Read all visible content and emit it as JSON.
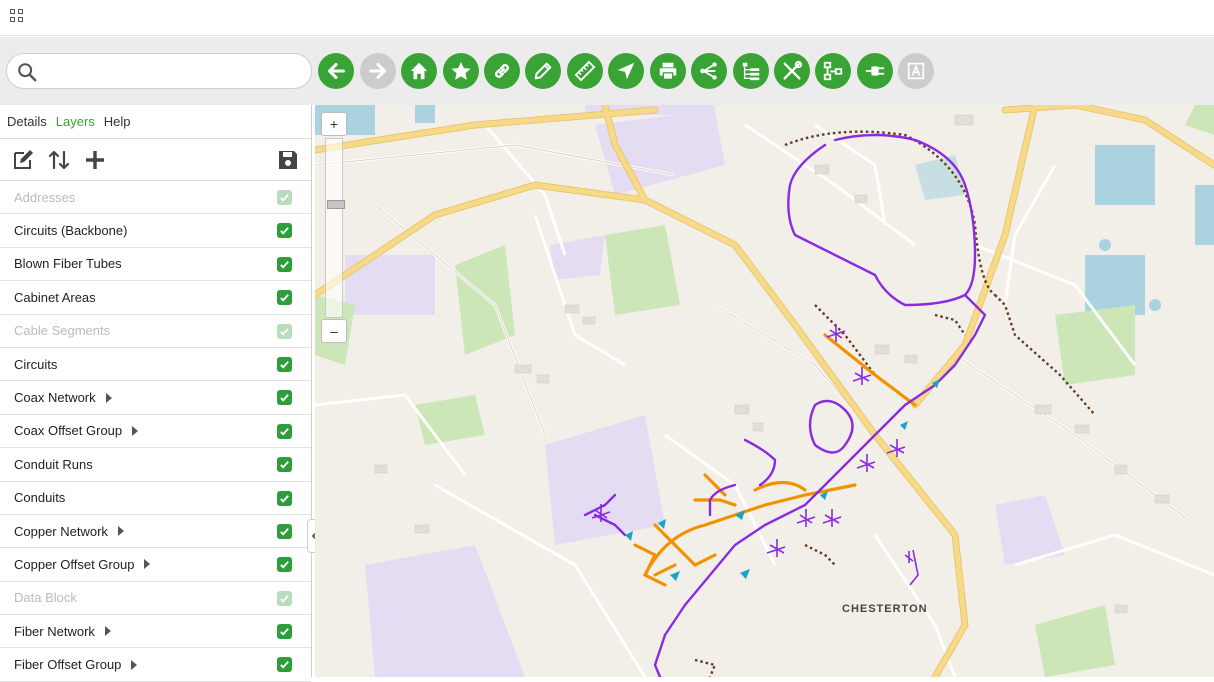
{
  "app": {
    "grid_icon": "apps-grid-icon"
  },
  "search": {
    "placeholder": "",
    "icon": "search-icon"
  },
  "toolbar": {
    "buttons": [
      {
        "icon": "arrow-left-icon",
        "enabled": true
      },
      {
        "icon": "arrow-right-icon",
        "enabled": false
      },
      {
        "icon": "home-icon",
        "enabled": true
      },
      {
        "icon": "star-icon",
        "enabled": true
      },
      {
        "icon": "link-icon",
        "enabled": true
      },
      {
        "icon": "pencil-icon",
        "enabled": true
      },
      {
        "icon": "ruler-icon",
        "enabled": true
      },
      {
        "icon": "navigate-icon",
        "enabled": true
      },
      {
        "icon": "printer-icon",
        "enabled": true
      },
      {
        "icon": "share-icon",
        "enabled": true
      },
      {
        "icon": "tree-list-icon",
        "enabled": true
      },
      {
        "icon": "tools-icon",
        "enabled": true
      },
      {
        "icon": "network-diagram-icon",
        "enabled": true
      },
      {
        "icon": "plug-icon",
        "enabled": true
      },
      {
        "icon": "text-tool-icon",
        "enabled": false
      }
    ],
    "accent": "#3aa335",
    "disabled_color": "#cccccc"
  },
  "panel": {
    "tabs": [
      {
        "label": "Details",
        "active": false
      },
      {
        "label": "Layers",
        "active": true
      },
      {
        "label": "Help",
        "active": false
      }
    ],
    "tools": [
      "edit-icon",
      "sort-icon",
      "add-icon",
      "save-icon"
    ],
    "layers": [
      {
        "label": "Addresses",
        "enabled": false,
        "checked": true,
        "expandable": false
      },
      {
        "label": "Circuits (Backbone)",
        "enabled": true,
        "checked": true,
        "expandable": false
      },
      {
        "label": "Blown Fiber Tubes",
        "enabled": true,
        "checked": true,
        "expandable": false
      },
      {
        "label": "Cabinet Areas",
        "enabled": true,
        "checked": true,
        "expandable": false
      },
      {
        "label": "Cable Segments",
        "enabled": false,
        "checked": true,
        "expandable": false
      },
      {
        "label": "Circuits",
        "enabled": true,
        "checked": true,
        "expandable": false
      },
      {
        "label": "Coax Network",
        "enabled": true,
        "checked": true,
        "expandable": true
      },
      {
        "label": "Coax Offset Group",
        "enabled": true,
        "checked": true,
        "expandable": true
      },
      {
        "label": "Conduit Runs",
        "enabled": true,
        "checked": true,
        "expandable": false
      },
      {
        "label": "Conduits",
        "enabled": true,
        "checked": true,
        "expandable": false
      },
      {
        "label": "Copper Network",
        "enabled": true,
        "checked": true,
        "expandable": true
      },
      {
        "label": "Copper Offset Group",
        "enabled": true,
        "checked": true,
        "expandable": true
      },
      {
        "label": "Data Block",
        "enabled": false,
        "checked": true,
        "expandable": false
      },
      {
        "label": "Fiber Network",
        "enabled": true,
        "checked": true,
        "expandable": true
      },
      {
        "label": "Fiber Offset Group",
        "enabled": true,
        "checked": true,
        "expandable": true
      }
    ],
    "check_color": "#2e9e3b"
  },
  "map": {
    "zoom_in": "+",
    "zoom_out": "–",
    "zoom_level_fraction": 0.5,
    "place_label": "CHESTERTON",
    "colors": {
      "fiber": "#8a2be2",
      "conduit": "#f39200",
      "duct": "#6b3a1a",
      "node": "#1aa3c4",
      "water": "#aad3df",
      "park": "#cde6b8",
      "industrial": "#e4dcf2",
      "road_major": "#f7d98a"
    }
  }
}
